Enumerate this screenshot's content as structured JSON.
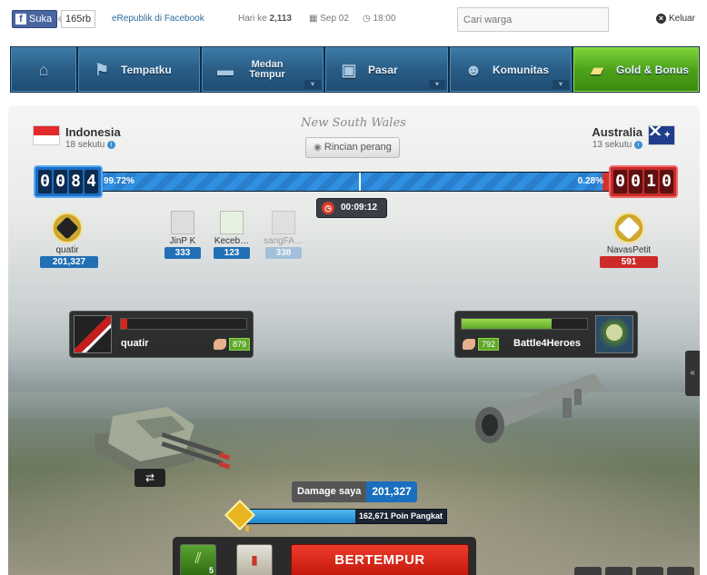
{
  "topbar": {
    "like_label": "Suka",
    "like_count": "165rb",
    "erepublik_fb": "eRepublik di Facebook",
    "day_prefix": "Hari ke",
    "day_number": "2,113",
    "date": "Sep 02",
    "time": "18:00",
    "search_placeholder": "Cari warga",
    "logout": "Keluar"
  },
  "nav": {
    "home_icon": "home-icon",
    "items": [
      {
        "label": "Tempatku",
        "icon": "flag-icon"
      },
      {
        "label": "Medan Tempur",
        "icon": "tank-icon"
      },
      {
        "label": "Pasar",
        "icon": "shopping-bag-icon"
      },
      {
        "label": "Komunitas",
        "icon": "people-icon"
      },
      {
        "label": "Gold & Bonus",
        "icon": "gold-bars-icon"
      }
    ]
  },
  "battle": {
    "region": "New South Wales",
    "details_button": "Rincian perang",
    "left": {
      "country": "Indonesia",
      "allies": "18 sekutu",
      "score_digits": [
        "0",
        "0",
        "8",
        "4"
      ],
      "percent": "99.72%",
      "percent_value": 99.72,
      "color": "#1b6cc2"
    },
    "right": {
      "country": "Australia",
      "allies": "13 sekutu",
      "score_digits": [
        "0",
        "0",
        "1",
        "0"
      ],
      "percent": "0.28%",
      "percent_value": 0.28,
      "color": "#c42b2a"
    },
    "timer": "00:09:12",
    "heroes_left": [
      {
        "name": "quatir",
        "damage": "201,327",
        "style": "blue",
        "medal": true
      },
      {
        "name": "JinP K",
        "damage": "333",
        "style": "blue",
        "medal": false
      },
      {
        "name": "Keceb…",
        "damage": "123",
        "style": "blue",
        "medal": false
      },
      {
        "name": "sangFA…",
        "damage": "338",
        "style": "pale",
        "medal": false
      }
    ],
    "hero_right": {
      "name": "NavasPetit",
      "damage": "591"
    },
    "fighter_left": {
      "name": "quatir",
      "power": "879",
      "health": 0.05
    },
    "fighter_right": {
      "name": "Battle4Heroes",
      "power": "792",
      "health": 0.72
    },
    "damage_label": "Damage saya",
    "damage_value": "201,327",
    "rank_text": "162,671 Poin Pangkat",
    "rank_progress": 0.55,
    "item_count": "5",
    "fight_button": "BERTEMPUR"
  }
}
